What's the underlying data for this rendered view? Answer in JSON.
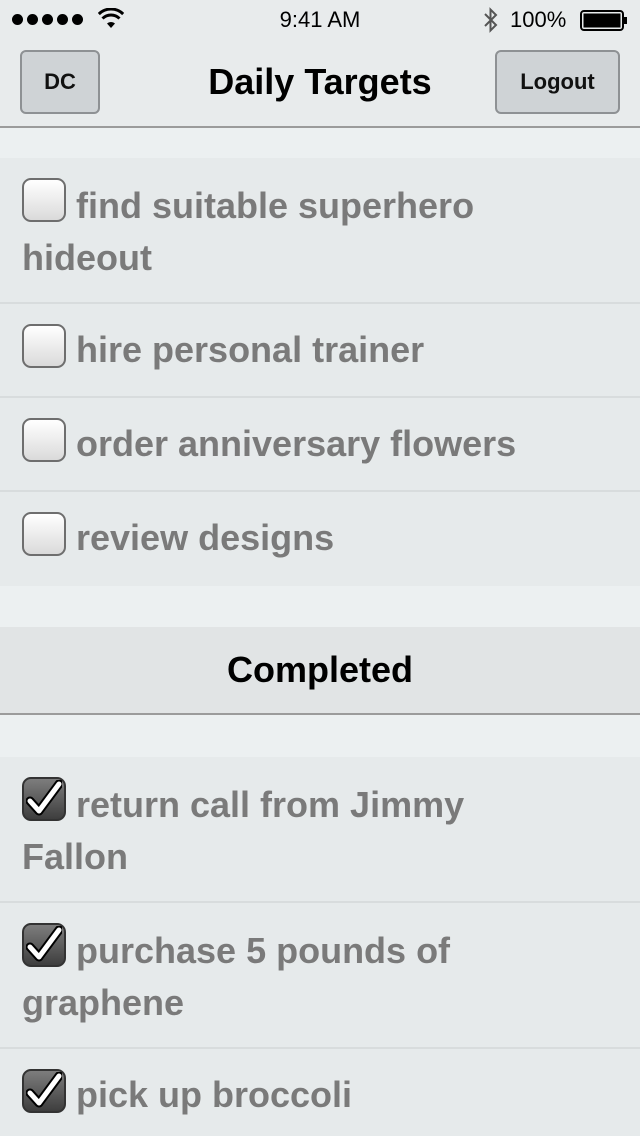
{
  "status_bar": {
    "time": "9:41 AM",
    "battery": "100%"
  },
  "nav": {
    "left_button": "DC",
    "title": "Daily Targets",
    "right_button": "Logout"
  },
  "pending_tasks": [
    {
      "label": "find suitable superhero hideout",
      "line1": "find suitable superhero",
      "line2": "hideout",
      "checked": false
    },
    {
      "label": "hire personal trainer",
      "line1": "hire personal trainer",
      "line2": "",
      "checked": false
    },
    {
      "label": "order anniversary flowers",
      "line1": "order anniversary flowers",
      "line2": "",
      "checked": false
    },
    {
      "label": "review designs",
      "line1": "review designs",
      "line2": "",
      "checked": false
    }
  ],
  "completed_section": {
    "title": "Completed"
  },
  "completed_tasks": [
    {
      "label": "return call from Jimmy Fallon",
      "line1": "return call from Jimmy",
      "line2": "Fallon",
      "checked": true
    },
    {
      "label": "purchase 5 pounds of graphene",
      "line1": "purchase 5 pounds of",
      "line2": "graphene",
      "checked": true
    },
    {
      "label": "pick up broccoli",
      "line1": "pick up broccoli",
      "line2": "",
      "checked": true
    }
  ]
}
